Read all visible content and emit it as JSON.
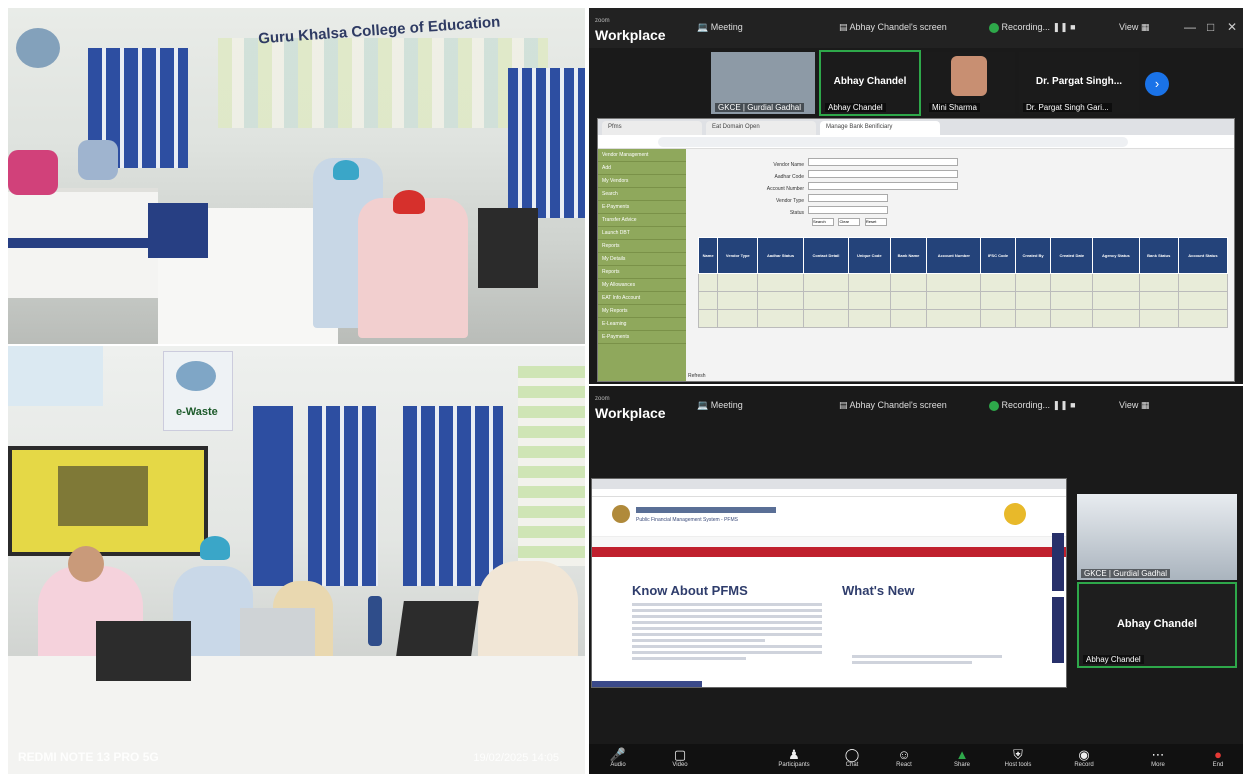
{
  "photos": {
    "college_sign": "Guru Khalsa College of Education",
    "ewaste_label": "e-Waste",
    "camera_watermark": "REDMI NOTE 13 PRO 5G",
    "timestamp_watermark": "19/02/2025 14:05"
  },
  "zoom_top": {
    "app_name": "Workplace",
    "app_sub": "zoom",
    "meeting_label": "Meeting",
    "screen_label": "Abhay Chandel's screen",
    "recording_label": "Recording...",
    "view_label": "View",
    "participants": [
      {
        "tile_label": "GKCE | Gurdial Gadhal",
        "big_name": ""
      },
      {
        "tile_label": "Abhay Chandel",
        "big_name": "Abhay Chandel"
      },
      {
        "tile_label": "Mini Sharma",
        "big_name": ""
      },
      {
        "tile_label": "Dr. Pargat Singh Gari...",
        "big_name": "Dr. Pargat Singh..."
      }
    ],
    "browser_tabs": [
      "Pfms",
      "Eat Domain Open",
      "Manage Bank Benificiary"
    ],
    "sidebar_items": [
      "Vendor Management",
      "Add",
      "My Vendors",
      "Search",
      "E-Payments",
      "Transfer Advice",
      "Launch DBT",
      "Reports",
      "My Details",
      "Reports",
      "My Allowances",
      "EAT Info Account",
      "My Reports",
      "E-Learning",
      "E-Payments"
    ],
    "form_labels": [
      "Vendor Name",
      "Aadhar Code",
      "Account Number",
      "Vendor Type",
      "Status"
    ],
    "form_buttons": [
      "Search",
      "Clear",
      "Reset"
    ],
    "table_headers": [
      "Name",
      "Vendor Type",
      "Aadhar Status",
      "Contact Detail",
      "Unique Code",
      "Bank Name",
      "Account Number",
      "IFSC Code",
      "Created By",
      "Created Date",
      "Agency Status",
      "Bank Status",
      "Account Status"
    ],
    "status_label": "Refresh"
  },
  "zoom_bottom": {
    "app_name": "Workplace",
    "app_sub": "zoom",
    "meeting_label": "Meeting",
    "screen_label": "Abhay Chandel's screen",
    "recording_label": "Recording...",
    "view_label": "View",
    "pfms_org": "Public Financial Management System - PFMS",
    "about_heading": "Know About PFMS",
    "news_heading": "What's New",
    "self_tile_label": "GKCE | Gurdial Gadhal",
    "active_speaker": "Abhay Chandel",
    "active_speaker_tile": "Abhay Chandel",
    "toolbar": [
      "Audio",
      "Video",
      "Participants",
      "Chat",
      "React",
      "Share",
      "Host tools",
      "Record",
      "More",
      "End"
    ]
  }
}
